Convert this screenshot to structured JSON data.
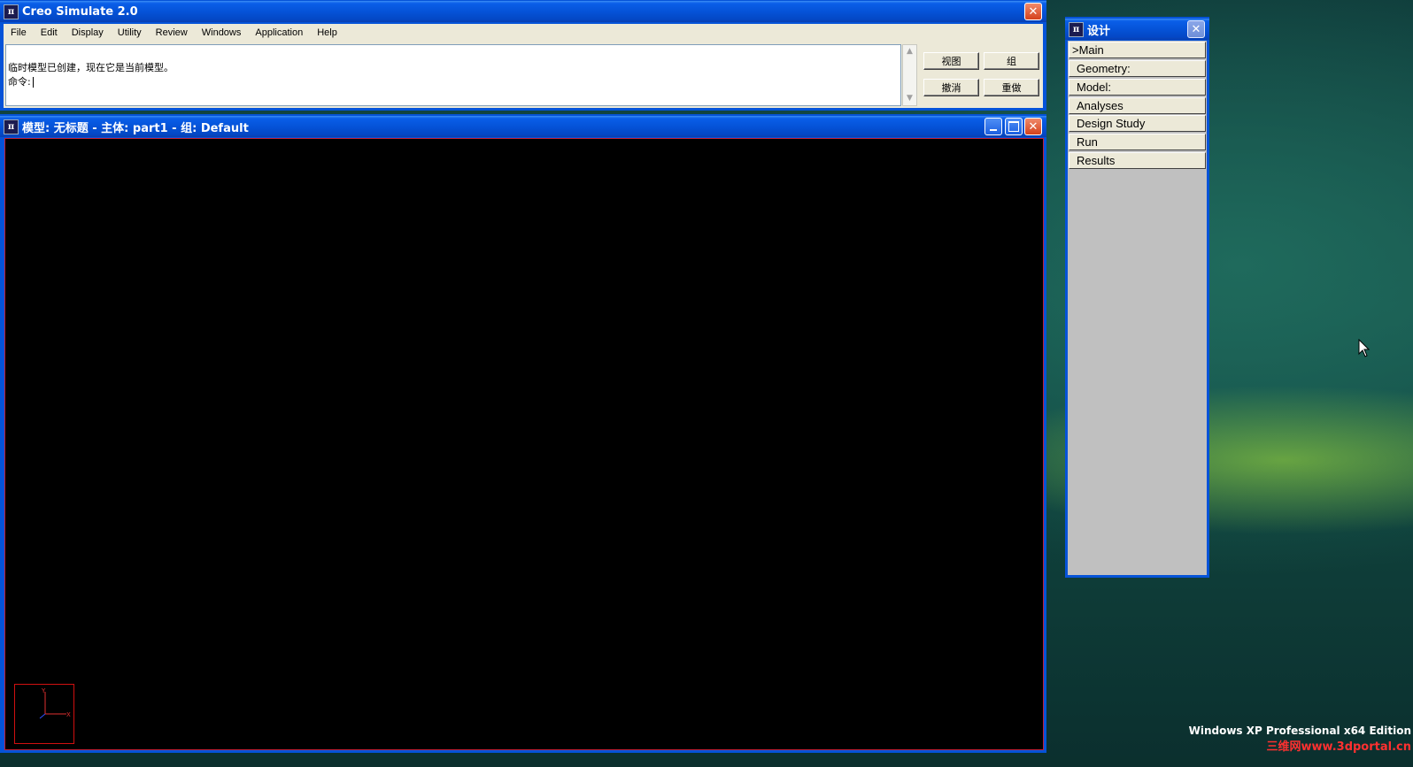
{
  "main_window": {
    "title": "Creo Simulate 2.0",
    "menu": [
      "File",
      "Edit",
      "Display",
      "Utility",
      "Review",
      "Windows",
      "Application",
      "Help"
    ],
    "messages": {
      "line1": "临时模型已创建，现在它是当前模型。",
      "prompt": "命令:"
    },
    "buttons": {
      "view": "视图",
      "group": "组",
      "undo": "撤消",
      "redo": "重做"
    }
  },
  "model_window": {
    "title": "模型: 无标题 - 主体: part1 - 组: Default"
  },
  "design_panel": {
    "title": "设计",
    "items": [
      ">Main",
      "Geometry:",
      "Model:",
      "Analyses",
      "Design Study",
      "Run",
      "Results"
    ]
  },
  "desktop": {
    "os_label": "Windows XP Professional x64 Edition",
    "watermark": "三维网www.3dportal.cn"
  },
  "colors": {
    "titlebar": "#0553d8",
    "viewport": "#000000",
    "triad_border": "#d01010"
  }
}
